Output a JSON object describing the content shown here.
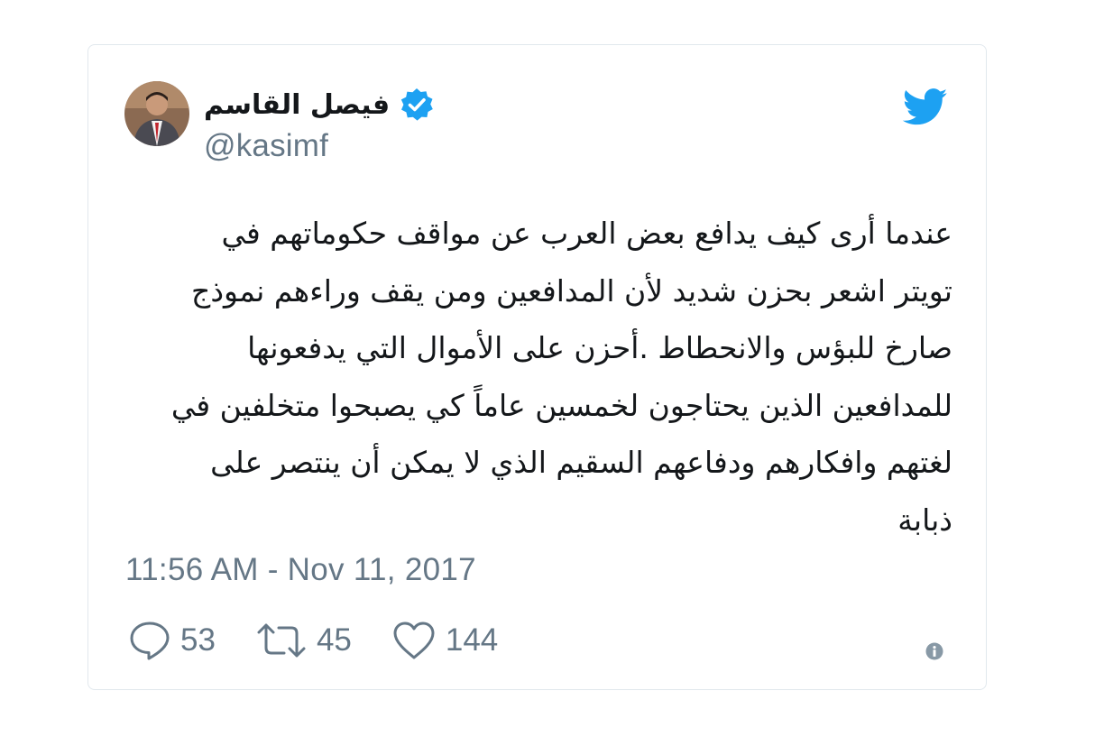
{
  "author": {
    "display_name": "فيصل القاسم",
    "handle": "@kasimf",
    "verified": true,
    "avatar_icon": "user-avatar-photo"
  },
  "tweet": {
    "lines": [
      "عندما أرى كيف يدافع بعض العرب عن مواقف حكوماتهم في",
      "تويتر اشعر بحزن شديد لأن المدافعين ومن يقف وراءهم نموذج",
      "صارخ للبؤس والانحطاط .أحزن على الأموال التي يدفعونها",
      "للمدافعين الذين يحتاجون لخمسين عاماً كي يصبحوا متخلفين في",
      "لغتهم وافكارهم ودفاعهم السقيم الذي لا يمكن أن ينتصر على",
      "ذبابة"
    ],
    "timestamp": "11:56 AM - Nov 11, 2017"
  },
  "stats": {
    "replies": "53",
    "retweets": "45",
    "likes": "144"
  },
  "icons": {
    "brand": "twitter-bird-icon",
    "verified": "verified-badge-icon",
    "reply": "reply-icon",
    "retweet": "retweet-icon",
    "like": "heart-icon",
    "info": "info-icon"
  },
  "colors": {
    "brand_blue": "#1da1f2",
    "text": "#14171a",
    "secondary": "#657786",
    "border": "#e1e8ed"
  }
}
